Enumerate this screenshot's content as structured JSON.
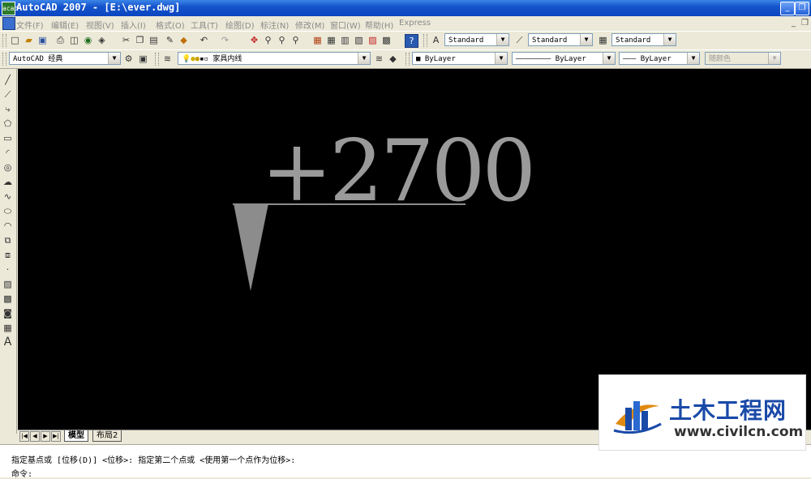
{
  "window": {
    "title": "AutoCAD 2007 - [E:\\ever.dwg]",
    "app_icon": "acad",
    "min": "_",
    "restore": "❐"
  },
  "menu": {
    "items": [
      "文件(F)",
      "编辑(E)",
      "视图(V)",
      "插入(I)",
      "格式(O)",
      "工具(T)",
      "绘图(D)",
      "标注(N)",
      "修改(M)",
      "窗口(W)",
      "帮助(H)",
      "Express"
    ],
    "doc_min": "_",
    "doc_restore": "❐"
  },
  "toolbar": {
    "text_style": "Standard",
    "dim_style": "Standard",
    "table_style": "Standard",
    "workspace": "AutoCAD 经典",
    "layer": "家具内线",
    "color": "ByLayer",
    "linetype": "ByLayer",
    "lineweight": "ByLayer",
    "plotstyle": "随颜色"
  },
  "drawing": {
    "elevation_text": "+2700",
    "text_color": "#9a9a9a",
    "background": "#000000"
  },
  "tabs": {
    "model": "模型",
    "layout": "布局2"
  },
  "command": {
    "line1": "指定基点或 [位移(D)] <位移>:  指定第二个点或 <使用第一个点作为位移>:",
    "line2": "命令:"
  },
  "watermark": {
    "name": "土木工程网",
    "url": "www.civilcn.com"
  }
}
